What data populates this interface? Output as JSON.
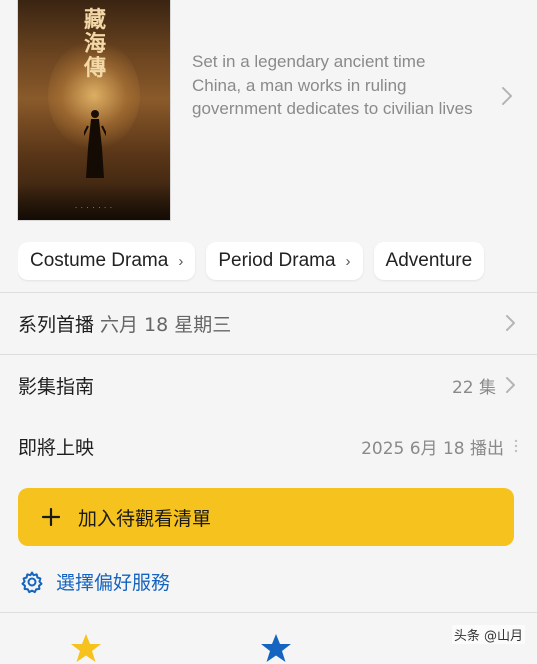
{
  "poster": {
    "title": "藏海傳"
  },
  "synopsis": {
    "text": "Set in a legendary ancient time China, a man works in ruling government dedicates to civilian lives"
  },
  "genres": [
    "Costume Drama",
    "Period Drama",
    "Adventure"
  ],
  "details": {
    "premiere_label": "系列首播",
    "premiere_date": "六月 18 星期三",
    "guide_label": "影集指南",
    "guide_count": "22 集",
    "upcoming_label": "即將上映",
    "upcoming_date": "2025 6月 18 播出"
  },
  "actions": {
    "watchlist_label": "加入待觀看清單",
    "preferences_label": "選擇偏好服務"
  },
  "watermark": "头条 @山月",
  "colors": {
    "accent_yellow": "#f5c21e",
    "link_blue": "#1565c0",
    "background": "#f5f5f5"
  },
  "icons": {
    "synopsis": "chevron-right-icon",
    "watchlist": "plus-icon",
    "preferences": "gear-icon",
    "rating_left": "star-icon",
    "rating_right": "star-icon"
  }
}
